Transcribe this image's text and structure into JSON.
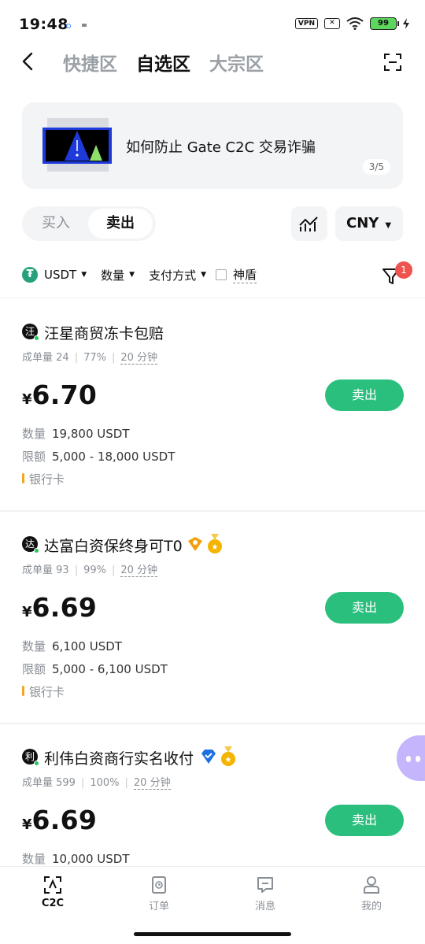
{
  "status": {
    "time": "19:48",
    "vpn": "VPN",
    "battery": "99"
  },
  "header": {
    "tabs": [
      "快捷区",
      "自选区",
      "大宗区"
    ],
    "active_tab": 1
  },
  "banner": {
    "text": "如何防止 Gate C2C 交易诈骗",
    "page": "3/5"
  },
  "trade": {
    "buy_label": "买入",
    "sell_label": "卖出",
    "currency": "CNY"
  },
  "filters": {
    "coin": "USDT",
    "amount": "数量",
    "payment": "支付方式",
    "shield": "神盾",
    "badge_count": "1"
  },
  "listings": [
    {
      "avatar": "汪",
      "name": "汪星商贸冻卡包赔",
      "orders": "成单量 24",
      "rate": "77%",
      "time": "20 分钟",
      "currency_symbol": "¥",
      "price": "6.70",
      "amount_label": "数量",
      "amount": "19,800 USDT",
      "limit_label": "限额",
      "limit": "5,000 - 18,000 USDT",
      "payment": "银行卡",
      "action": "卖出"
    },
    {
      "avatar": "达",
      "name": "达富白资保终身可T0",
      "orders": "成单量 93",
      "rate": "99%",
      "time": "20 分钟",
      "currency_symbol": "¥",
      "price": "6.69",
      "amount_label": "数量",
      "amount": "6,100 USDT",
      "limit_label": "限额",
      "limit": "5,000 - 6,100 USDT",
      "payment": "银行卡",
      "action": "卖出"
    },
    {
      "avatar": "利",
      "name": "利伟白资商行实名收付",
      "orders": "成单量 599",
      "rate": "100%",
      "time": "20 分钟",
      "currency_symbol": "¥",
      "price": "6.69",
      "amount_label": "数量",
      "amount": "10,000 USDT",
      "action": "卖出"
    }
  ],
  "nav": {
    "items": [
      "C2C",
      "订单",
      "消息",
      "我的"
    ],
    "active": 0
  },
  "colors": {
    "accent": "#2bbf7e",
    "badge": "#ef5350",
    "payment_bar": "#f4a522"
  }
}
